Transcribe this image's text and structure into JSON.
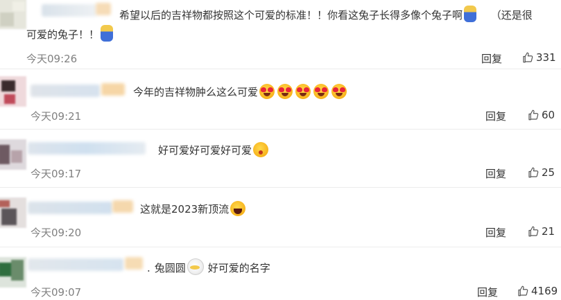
{
  "comments": [
    {
      "text_line1": "希望以后的吉祥物都按照这个可爱的标准！！你看这兔子长得多像个兔子啊",
      "text_line1_tail": "（还是很",
      "text_line2": "可爱的兔子！！",
      "time": "今天09:26",
      "reply_label": "回复",
      "likes": "331"
    },
    {
      "text": "今年的吉祥物肿么这么可爱",
      "time": "今天09:21",
      "reply_label": "回复",
      "likes": "60"
    },
    {
      "text": "好可爱好可爱好可爱",
      "time": "今天09:17",
      "reply_label": "回复",
      "likes": "25"
    },
    {
      "text": "这就是2023新顶流",
      "time": "今天09:20",
      "reply_label": "回复",
      "likes": "21"
    },
    {
      "text_pre": "兔圆圆",
      "text_post": "好可爱的名字",
      "time": "今天09:07",
      "reply_label": "回复",
      "likes": "4169"
    }
  ],
  "icons": {
    "like": "thumbs-up-icon",
    "emoji_heart_eyes": "heart-eyes-emoji-icon",
    "emoji_wink": "wink-kiss-emoji-icon",
    "emoji_laugh": "laughing-emoji-icon",
    "emoji_hug": "hug-emoji-icon",
    "emoji_person": "person-emoji-icon"
  },
  "colors": {
    "text": "#333333",
    "time": "#808080",
    "divider": "#ececec"
  }
}
